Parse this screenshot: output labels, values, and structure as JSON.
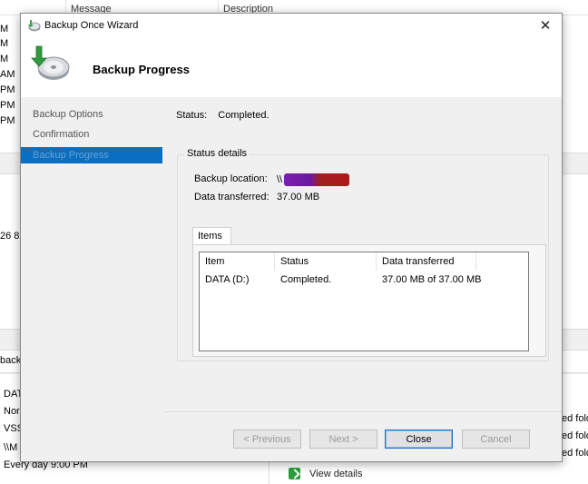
{
  "background": {
    "columns": [
      "Message",
      "Description"
    ],
    "left_times": [
      "M",
      "M",
      "M",
      "AM",
      "PM",
      "PM",
      "PM"
    ],
    "left_snippets": {
      "s1": "26 8:",
      "s2": "backu",
      "s3": "DAT",
      "s4": "Nor",
      "s5": "VSS",
      "s6": "\\\\M",
      "s7": "Every day 9:00 PM"
    },
    "right_snippets": [
      "ed fold",
      "ed fold",
      "ed fold"
    ],
    "view_details_label": "View details"
  },
  "dialog": {
    "title": "Backup Once Wizard",
    "close_glyph": "✕",
    "header_title": "Backup Progress",
    "nav": [
      {
        "label": "Backup Options",
        "active": false
      },
      {
        "label": "Confirmation",
        "active": false
      },
      {
        "label": "Backup Progress",
        "active": true
      }
    ],
    "status_label": "Status:",
    "status_value": "Completed.",
    "status_details_title": "Status details",
    "backup_location_label": "Backup location:",
    "backup_location_value": "\\\\",
    "data_transferred_label": "Data transferred:",
    "data_transferred_value": "37.00 MB",
    "items_tab_label": "Items",
    "table": {
      "headers": [
        "Item",
        "Status",
        "Data transferred"
      ],
      "rows": [
        [
          "DATA (D:)",
          "Completed.",
          "37.00 MB of 37.00 MB"
        ]
      ]
    },
    "buttons": {
      "previous": "< Previous",
      "next": "Next >",
      "close": "Close",
      "cancel": "Cancel"
    }
  }
}
